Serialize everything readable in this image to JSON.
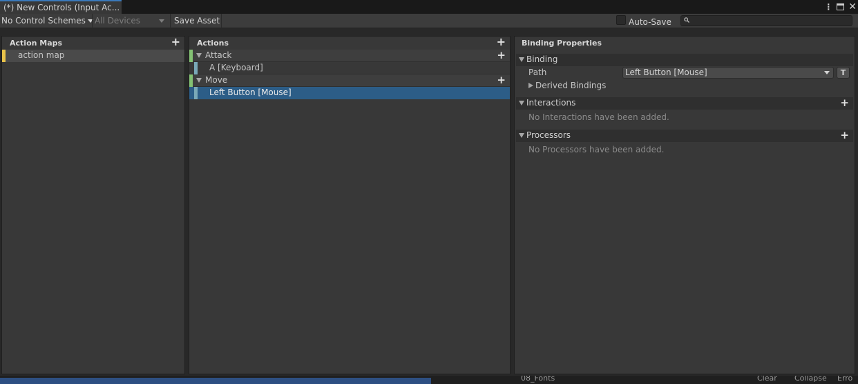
{
  "window": {
    "tab_title": "(*) New Controls (Input Ac...",
    "icons": [
      "more-vert-icon",
      "maximize-icon",
      "close-icon"
    ]
  },
  "toolbar": {
    "control_schemes": "No Control Schemes",
    "devices": "All Devices",
    "save_asset": "Save Asset",
    "auto_save": "Auto-Save",
    "auto_save_checked": false,
    "search_placeholder": ""
  },
  "action_maps": {
    "header": "Action Maps",
    "items": [
      {
        "label": "action map",
        "color": "#e9c34a"
      }
    ]
  },
  "actions": {
    "header": "Actions",
    "items": [
      {
        "label": "Attack",
        "color": "#84c274",
        "bindings": [
          {
            "label": "A [Keyboard]",
            "selected": false
          }
        ]
      },
      {
        "label": "Move",
        "color": "#84c274",
        "bindings": [
          {
            "label": "Left Button [Mouse]",
            "selected": true
          }
        ]
      }
    ],
    "binding_color": "#7aa9b8"
  },
  "properties": {
    "header": "Binding Properties",
    "binding_section": "Binding",
    "path_label": "Path",
    "path_value": "Left Button [Mouse]",
    "t_button": "T",
    "derived_bindings": "Derived Bindings",
    "interactions_section": "Interactions",
    "interactions_empty": "No Interactions have been added.",
    "processors_section": "Processors",
    "processors_empty": "No Processors have been added."
  },
  "bottom": {
    "folder": "08_Fonts",
    "clear": "Clear",
    "collapse": "Collapse",
    "error": "Erro"
  },
  "colors": {
    "selection": "#2c5d87",
    "accent": "#3a79bb"
  }
}
